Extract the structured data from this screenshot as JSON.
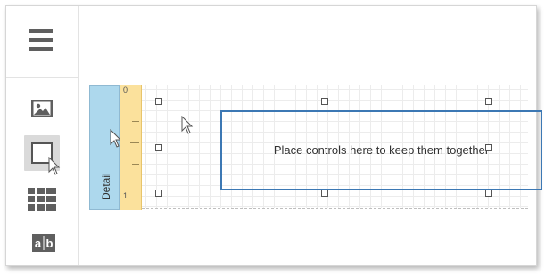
{
  "toolbox": {
    "menu_icon": "hamburger-menu-icon",
    "tools": [
      {
        "name": "image-tool",
        "icon": "image-icon"
      },
      {
        "name": "panel-tool",
        "icon": "panel-square-icon",
        "selected": true
      },
      {
        "name": "table-tool",
        "icon": "table-grid-icon"
      },
      {
        "name": "label-tool",
        "icon": "text-label-icon",
        "text": "ab"
      }
    ]
  },
  "designer": {
    "band": {
      "label": "Detail",
      "color": "#add8ed"
    },
    "ruler": {
      "labels": [
        "0",
        "1"
      ],
      "color": "#fbe19c"
    },
    "panel": {
      "text": "Place controls here to keep them together",
      "border_color": "#3c78b4"
    }
  }
}
